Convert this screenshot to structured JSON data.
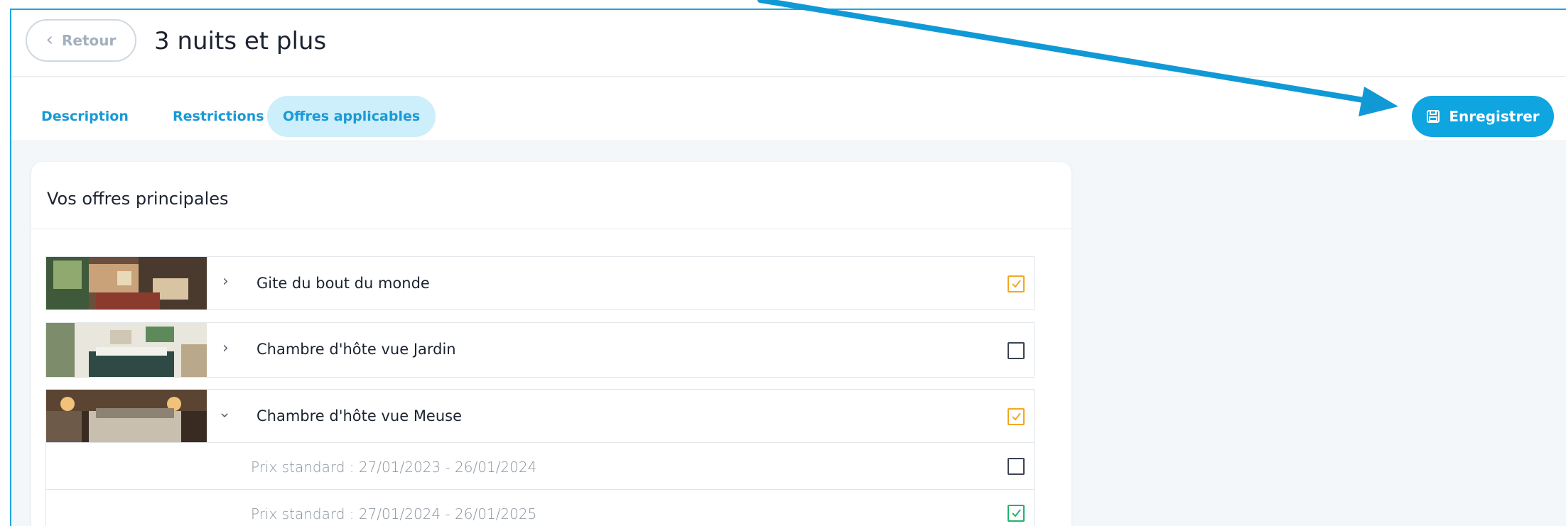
{
  "header": {
    "back_label": "Retour",
    "title": "3 nuits et plus"
  },
  "tabs": [
    {
      "label": "Description",
      "active": false
    },
    {
      "label": "Restrictions",
      "active": false
    },
    {
      "label": "Offres applicables",
      "active": true
    }
  ],
  "toolbar": {
    "save_label": "Enregistrer",
    "save_icon": "floppy-disk-icon"
  },
  "card": {
    "title": "Vos offres principales",
    "offers": [
      {
        "name": "Gite du bout du monde",
        "expanded": false,
        "checked": true,
        "check_color": "#f5a623"
      },
      {
        "name": "Chambre d'hôte vue Jardin",
        "expanded": false,
        "checked": false
      },
      {
        "name": "Chambre d'hôte vue Meuse",
        "expanded": true,
        "checked": true,
        "check_color": "#f5a623",
        "rates": [
          {
            "label": "Prix standard : 27/01/2023 - 26/01/2024",
            "checked": false
          },
          {
            "label": "Prix standard : 27/01/2024 - 26/01/2025",
            "checked": true,
            "check_color": "#23b26d"
          }
        ]
      }
    ]
  },
  "colors": {
    "accent": "#0ea5e0",
    "tab_active_bg": "#cdeefb",
    "annotation_arrow": "#1199d6"
  }
}
